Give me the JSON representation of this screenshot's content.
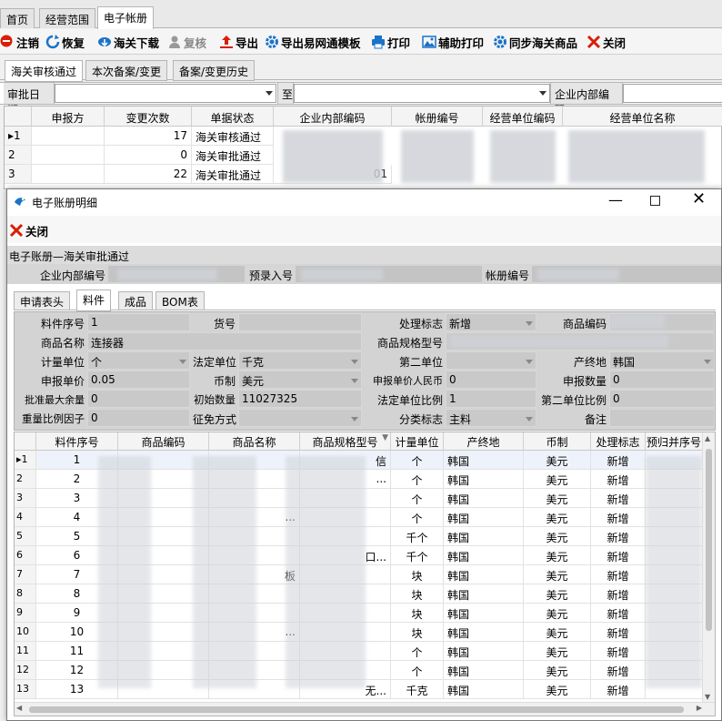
{
  "top_tabs": [
    "首页",
    "经营范围",
    "电子帐册"
  ],
  "toolbar": [
    {
      "label": "注销",
      "icon": "cancel-icon",
      "color": "#d81e06"
    },
    {
      "label": "恢复",
      "icon": "refresh-icon",
      "color": "#1a73c8"
    },
    {
      "label": "海关下载",
      "icon": "cloud-download-icon",
      "color": "#1a73c8"
    },
    {
      "label": "复核",
      "icon": "user-icon",
      "color": "#888888",
      "disabled": true
    },
    {
      "label": "导出",
      "icon": "export-icon",
      "color": "#d81e06"
    },
    {
      "label": "导出易网通模板",
      "icon": "gear-icon",
      "color": "#1a73c8"
    },
    {
      "label": "打印",
      "icon": "printer-icon",
      "color": "#1a73c8"
    },
    {
      "label": "辅助打印",
      "icon": "image-icon",
      "color": "#1a73c8"
    },
    {
      "label": "同步海关商品",
      "icon": "gear-icon",
      "color": "#1a73c8"
    },
    {
      "label": "关闭",
      "icon": "close-icon",
      "color": "#d81e06"
    }
  ],
  "sub_tabs": [
    "海关审核通过",
    "本次备案/变更",
    "备案/变更历史"
  ],
  "filter": {
    "date_label": "审批日期",
    "to_label": "至",
    "code_label": "企业内部编码"
  },
  "grid1": {
    "headers": [
      "申报方",
      "变更次数",
      "单据状态",
      "企业内部编码",
      "帐册编号",
      "经营单位编码",
      "经营单位名称"
    ],
    "rows": [
      {
        "num": "1",
        "changes": "17",
        "status": "海关审核通过",
        "partial": ""
      },
      {
        "num": "2",
        "changes": "0",
        "status": "海关审批通过",
        "partial": ""
      },
      {
        "num": "3",
        "changes": "22",
        "status": "海关审批通过",
        "partial": "01"
      }
    ]
  },
  "dialog": {
    "title": "电子账册明细",
    "close_label": "关闭",
    "section": "电子账册—海关审批通过",
    "header_fields": {
      "code": "企业内部编号",
      "pre": "预录入号",
      "book": "帐册编号"
    },
    "tabs": [
      "申请表头",
      "料件",
      "成品",
      "BOM表"
    ],
    "form": {
      "item_no_label": "料件序号",
      "item_no": "1",
      "goods_no_label": "货号",
      "flag_label": "处理标志",
      "flag": "新增",
      "code_label": "商品编码",
      "name_label": "商品名称",
      "name": "连接器",
      "spec_label": "商品规格型号",
      "unit_label": "计量单位",
      "unit": "个",
      "legal_unit_label": "法定单位",
      "legal_unit": "千克",
      "second_unit_label": "第二单位",
      "origin_label": "产终地",
      "origin": "韩国",
      "price_label": "申报单价",
      "price": "0.05",
      "currency_label": "币制",
      "currency": "美元",
      "price_rmb_label": "申报单价人民币",
      "price_rmb": "0",
      "qty_label": "申报数量",
      "qty": "0",
      "max_label": "批准最大余量",
      "max": "0",
      "init_label": "初始数量",
      "init": "11027325",
      "legal_ratio_label": "法定单位比例",
      "legal_ratio": "1",
      "second_ratio_label": "第二单位比例",
      "second_ratio": "0",
      "weight_label": "重量比例因子",
      "weight": "0",
      "exempt_label": "征免方式",
      "class_label": "分类标志",
      "class": "主料",
      "remark_label": "备注"
    },
    "grid": {
      "headers": [
        "料件序号",
        "商品编码",
        "商品名称",
        "商品规格型号",
        "计量单位",
        "产终地",
        "币制",
        "处理标志",
        "预归并序号"
      ],
      "rows": [
        {
          "n": "1",
          "seq": "1",
          "name": "",
          "spec": "信",
          "unit": "个",
          "origin": "韩国",
          "cur": "美元",
          "flag": "新增"
        },
        {
          "n": "2",
          "seq": "2",
          "name": "",
          "spec": "...",
          "unit": "个",
          "origin": "韩国",
          "cur": "美元",
          "flag": "新增"
        },
        {
          "n": "3",
          "seq": "3",
          "name": "",
          "spec": "",
          "unit": "个",
          "origin": "韩国",
          "cur": "美元",
          "flag": "新增"
        },
        {
          "n": "4",
          "seq": "4",
          "name": "...",
          "spec": "",
          "unit": "个",
          "origin": "韩国",
          "cur": "美元",
          "flag": "新增"
        },
        {
          "n": "5",
          "seq": "5",
          "name": "",
          "spec": "",
          "unit": "千个",
          "origin": "韩国",
          "cur": "美元",
          "flag": "新增"
        },
        {
          "n": "6",
          "seq": "6",
          "name": "",
          "spec": "口...",
          "unit": "千个",
          "origin": "韩国",
          "cur": "美元",
          "flag": "新增"
        },
        {
          "n": "7",
          "seq": "7",
          "name": "板",
          "spec": "",
          "unit": "块",
          "origin": "韩国",
          "cur": "美元",
          "flag": "新增"
        },
        {
          "n": "8",
          "seq": "8",
          "name": "",
          "spec": "",
          "unit": "块",
          "origin": "韩国",
          "cur": "美元",
          "flag": "新增"
        },
        {
          "n": "9",
          "seq": "9",
          "name": "",
          "spec": "",
          "unit": "块",
          "origin": "韩国",
          "cur": "美元",
          "flag": "新增"
        },
        {
          "n": "10",
          "seq": "10",
          "name": "...",
          "spec": "",
          "unit": "块",
          "origin": "韩国",
          "cur": "美元",
          "flag": "新增"
        },
        {
          "n": "11",
          "seq": "11",
          "name": "",
          "spec": "",
          "unit": "个",
          "origin": "韩国",
          "cur": "美元",
          "flag": "新增"
        },
        {
          "n": "12",
          "seq": "12",
          "name": "",
          "spec": "",
          "unit": "个",
          "origin": "韩国",
          "cur": "美元",
          "flag": "新增"
        },
        {
          "n": "13",
          "seq": "13",
          "name": "",
          "spec": "无...",
          "unit": "千克",
          "origin": "韩国",
          "cur": "美元",
          "flag": "新增"
        }
      ]
    }
  }
}
